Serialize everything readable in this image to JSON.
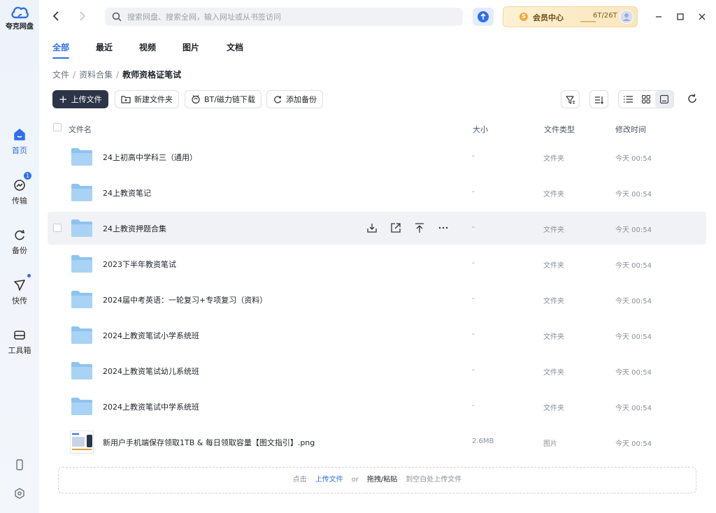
{
  "app": {
    "name": "夸克网盘"
  },
  "colors": {
    "accent": "#2f6fec",
    "primary_button": "#2c3448",
    "folder": "#8ec3ef",
    "vip_gold": "#fbe6bd"
  },
  "sidebar": {
    "items": [
      {
        "label": "首页",
        "icon": "home-icon",
        "active": true
      },
      {
        "label": "传输",
        "icon": "transfer-icon",
        "badge": "1"
      },
      {
        "label": "备份",
        "icon": "backup-icon"
      },
      {
        "label": "快传",
        "icon": "send-icon",
        "dot": true
      },
      {
        "label": "工具箱",
        "icon": "toolbox-icon"
      }
    ],
    "bottom": [
      {
        "icon": "phone-icon"
      },
      {
        "icon": "settings-icon"
      }
    ]
  },
  "topbar": {
    "search_placeholder": "搜索网盘、搜索全网，输入网址或从书签访问",
    "vip_label": "会员中心",
    "vip_coin": "S",
    "quota": "6T/26T"
  },
  "tabs": [
    {
      "label": "全部",
      "active": true
    },
    {
      "label": "最近"
    },
    {
      "label": "视频"
    },
    {
      "label": "图片"
    },
    {
      "label": "文档"
    }
  ],
  "breadcrumb": [
    "文件",
    "资料合集",
    "教师资格证笔试"
  ],
  "toolbar": {
    "upload": "上传文件",
    "new_folder": "新建文件夹",
    "bt_download": "BT/磁力链下载",
    "add_backup": "添加备份"
  },
  "columns": {
    "name": "文件名",
    "size": "大小",
    "type": "文件类型",
    "modified": "修改时间"
  },
  "files": [
    {
      "name": "24上初高中学科三（通用）",
      "size": "-",
      "type": "文件夹",
      "modified": "今天 00:54",
      "kind": "folder"
    },
    {
      "name": "24上教资笔记",
      "size": "-",
      "type": "文件夹",
      "modified": "今天 00:54",
      "kind": "folder"
    },
    {
      "name": "24上教资押题合集",
      "size": "-",
      "type": "文件夹",
      "modified": "今天 00:54",
      "kind": "folder",
      "hover": true
    },
    {
      "name": "2023下半年教资笔试",
      "size": "-",
      "type": "文件夹",
      "modified": "今天 00:54",
      "kind": "folder"
    },
    {
      "name": "2024届中考英语：一轮复习+专项复习（资料）",
      "size": "-",
      "type": "文件夹",
      "modified": "今天 00:54",
      "kind": "folder"
    },
    {
      "name": "2024上教资笔试小学系统班",
      "size": "-",
      "type": "文件夹",
      "modified": "今天 00:54",
      "kind": "folder"
    },
    {
      "name": "2024上教资笔试幼儿系统班",
      "size": "-",
      "type": "文件夹",
      "modified": "今天 00:54",
      "kind": "folder"
    },
    {
      "name": "2024上教资笔试中学系统班",
      "size": "-",
      "type": "文件夹",
      "modified": "今天 00:54",
      "kind": "folder"
    },
    {
      "name": "新用户手机端保存领取1TB & 每日领取容量【图文指引】.png",
      "size": "2.6MB",
      "type": "图片",
      "modified": "今天 00:54",
      "kind": "image"
    }
  ],
  "row_actions": [
    "download-icon",
    "share-icon",
    "move-to-top-icon",
    "more-icon"
  ],
  "dropzone": {
    "prefix": "点击",
    "upload_link": "上传文件",
    "or": "or",
    "drag": "拖拽/粘贴",
    "suffix": "到空白处上传文件"
  }
}
